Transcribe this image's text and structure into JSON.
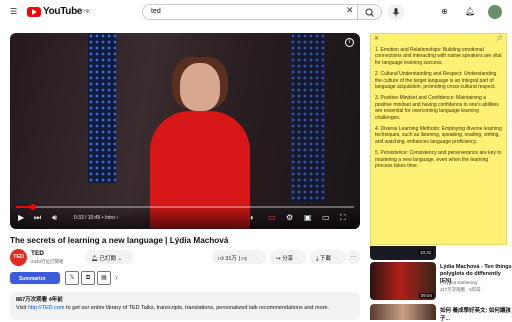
{
  "header": {
    "logo_text": "YouTube",
    "logo_region": "HK",
    "search_value": "ted"
  },
  "video": {
    "time_display": "0:33 / 10:45",
    "chapter": "Intro",
    "progress_fraction": 0.05,
    "title": "The secrets of learning a new language | Lýdia Machová"
  },
  "channel": {
    "avatar_text": "TED",
    "name": "TED",
    "subscribers": "2340万位訂閱者",
    "subscribed_label": "已訂閱",
    "likes": "31万",
    "share_label": "分享",
    "download_label": "下載"
  },
  "extension": {
    "summarize_label": "Summarize"
  },
  "description": {
    "views_date": "887万次观看  4年前",
    "line_prefix": "Visit ",
    "link": "http://TED.com",
    "line_suffix": " to get our entire library of TED Talks, transcripts, translations, personalized talk recommendations and more."
  },
  "note": {
    "items": [
      "1. Emotion and Relationships: Building emotional connections and interacting with native speakers are vital for language learning success.",
      "2. Cultural Understanding and Respect: Understanding the culture of the target language is an integral part of language acquisition, promoting cross-cultural respect.",
      "3. Positive Mindset and Confidence: Maintaining a positive mindset and having confidence in one's abilities are essential for overcoming language learning challenges.",
      "4. Diverse Learning Methods: Employing diverse learning techniques, such as listening, speaking, reading, writing, and watching, enhances language proficiency.",
      "5. Persistence: Consistency and perseverance are key to mastering a new language, even when the learning process takes time."
    ]
  },
  "recommendations": [
    {
      "duration": "10:31"
    },
    {
      "duration": "09:04",
      "title": "Lýdia Machová - Ten things polyglots do differently [EN]",
      "channel": "Polyglot Gathering",
      "meta": "117万次观看 · 5年前"
    },
    {
      "title": "如何 養成學好英文: 如何讓孩子..."
    }
  ],
  "colors": {
    "accent": "#ff0000",
    "note_bg": "#fff176",
    "summarize_bg": "#3b5bdb",
    "ted_red": "#e62b1e"
  }
}
